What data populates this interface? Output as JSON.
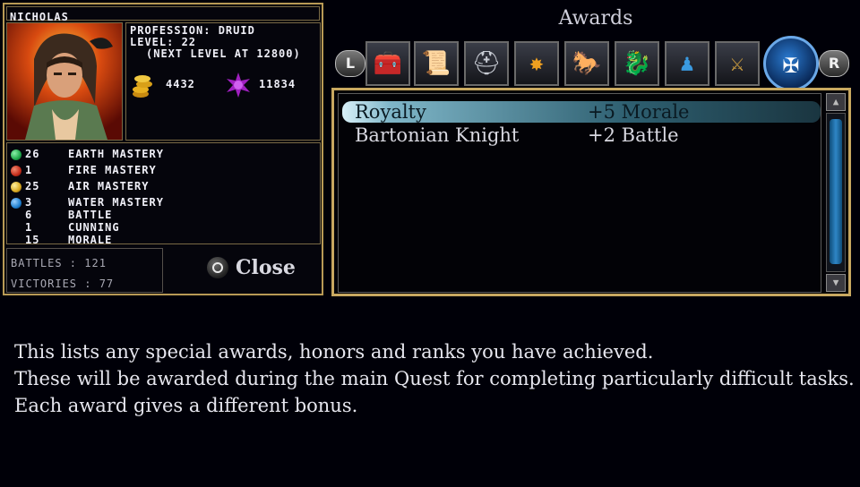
{
  "character": {
    "name": "NICHOLAS",
    "profession_line": "PROFESSION: DRUID",
    "level_line": "LEVEL: 22",
    "next_level_line": "(NEXT LEVEL AT 12800)",
    "gold": "4432",
    "mana": "11834",
    "stats": [
      {
        "value": "26",
        "label": "EARTH MASTERY",
        "color": "#1fa84a",
        "icon": "earth-orb-icon"
      },
      {
        "value": "1",
        "label": "FIRE MASTERY",
        "color": "#c42b1a",
        "icon": "fire-orb-icon"
      },
      {
        "value": "25",
        "label": "AIR MASTERY",
        "color": "#d8a820",
        "icon": "air-orb-icon"
      },
      {
        "value": "3",
        "label": "WATER MASTERY",
        "color": "#1e7fd0",
        "icon": "water-orb-icon"
      },
      {
        "value": "6",
        "label": "BATTLE"
      },
      {
        "value": "1",
        "label": "CUNNING"
      },
      {
        "value": "15",
        "label": "MORALE"
      }
    ],
    "battles_line": "BATTLES : 121",
    "victories_line": "VICTORIES : 77"
  },
  "close_label": "Close",
  "awards": {
    "title": "Awards",
    "left_button": "L",
    "right_button": "R",
    "tabs": [
      {
        "icon": "treasure-chest-icon",
        "glyph": "🧰"
      },
      {
        "icon": "scroll-icon",
        "glyph": "📜"
      },
      {
        "icon": "helmet-icon",
        "glyph": "⛑"
      },
      {
        "icon": "sun-burst-icon",
        "glyph": "✸"
      },
      {
        "icon": "horse-rider-icon",
        "glyph": "🐎"
      },
      {
        "icon": "dragon-shield-icon",
        "glyph": "🐉"
      },
      {
        "icon": "pawn-icon",
        "glyph": "♟"
      },
      {
        "icon": "flail-icon",
        "glyph": "⚔"
      }
    ],
    "active_tab": {
      "icon": "maltese-cross-icon",
      "glyph": "✠"
    },
    "items": [
      {
        "name": "Royalty",
        "bonus": "+5 Morale",
        "selected": true
      },
      {
        "name": "Bartonian Knight",
        "bonus": "+2 Battle",
        "selected": false
      }
    ],
    "scroll_up": "▲",
    "scroll_down": "▼"
  },
  "description": [
    "This lists any special awards, honors and ranks you have achieved.",
    "These will be awarded during the main Quest for completing particularly difficult tasks.",
    "Each award gives a different bonus."
  ],
  "colors": {
    "gold_border": "#c8a860",
    "selected_row": "#7fb6c8",
    "scroll_thumb": "#2f86c6"
  }
}
